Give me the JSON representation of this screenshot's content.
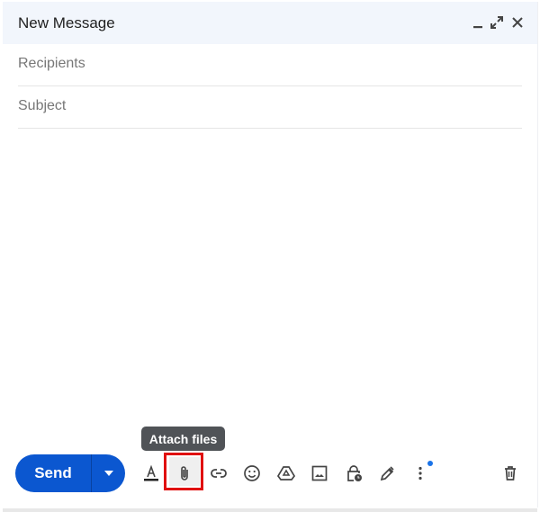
{
  "header": {
    "title": "New Message",
    "icons": [
      "minimize-icon",
      "expand-icon",
      "close-icon"
    ]
  },
  "fields": {
    "recipients_placeholder": "Recipients",
    "recipients_value": "",
    "subject_placeholder": "Subject",
    "subject_value": ""
  },
  "body": {
    "value": ""
  },
  "toolbar": {
    "send_label": "Send",
    "tooltip": "Attach files",
    "tools": [
      "formatting-options",
      "attach-files",
      "insert-link",
      "insert-emoji",
      "insert-drive-file",
      "insert-photo",
      "confidential-mode",
      "insert-signature",
      "more-options",
      "discard-draft"
    ]
  },
  "colors": {
    "send": "#0b57d0",
    "highlight": "#e01010",
    "notification_dot": "#1a73e8"
  }
}
